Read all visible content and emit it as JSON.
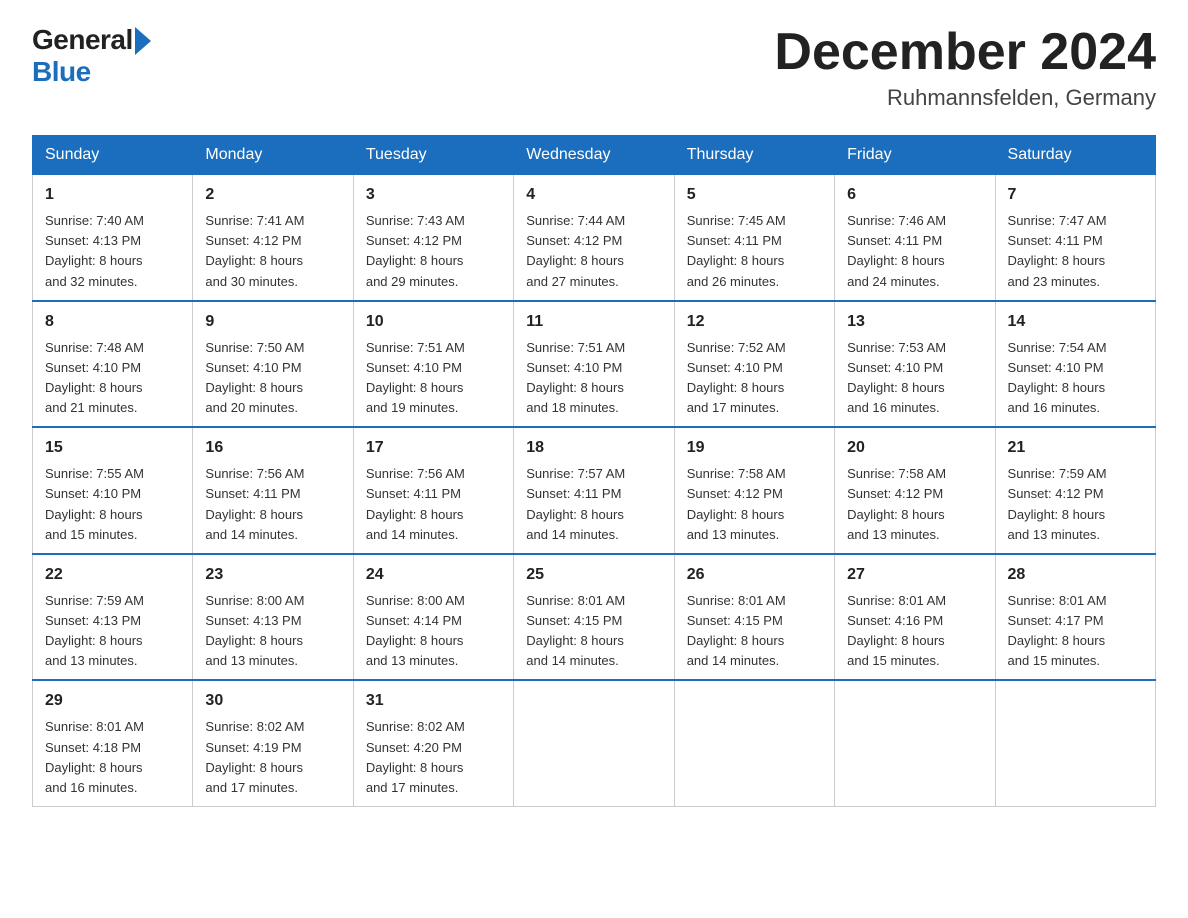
{
  "header": {
    "logo": {
      "general": "General",
      "blue": "Blue"
    },
    "title": "December 2024",
    "location": "Ruhmannsfelden, Germany"
  },
  "days_of_week": [
    "Sunday",
    "Monday",
    "Tuesday",
    "Wednesday",
    "Thursday",
    "Friday",
    "Saturday"
  ],
  "weeks": [
    [
      {
        "day": "1",
        "sunrise": "7:40 AM",
        "sunset": "4:13 PM",
        "daylight": "8 hours and 32 minutes."
      },
      {
        "day": "2",
        "sunrise": "7:41 AM",
        "sunset": "4:12 PM",
        "daylight": "8 hours and 30 minutes."
      },
      {
        "day": "3",
        "sunrise": "7:43 AM",
        "sunset": "4:12 PM",
        "daylight": "8 hours and 29 minutes."
      },
      {
        "day": "4",
        "sunrise": "7:44 AM",
        "sunset": "4:12 PM",
        "daylight": "8 hours and 27 minutes."
      },
      {
        "day": "5",
        "sunrise": "7:45 AM",
        "sunset": "4:11 PM",
        "daylight": "8 hours and 26 minutes."
      },
      {
        "day": "6",
        "sunrise": "7:46 AM",
        "sunset": "4:11 PM",
        "daylight": "8 hours and 24 minutes."
      },
      {
        "day": "7",
        "sunrise": "7:47 AM",
        "sunset": "4:11 PM",
        "daylight": "8 hours and 23 minutes."
      }
    ],
    [
      {
        "day": "8",
        "sunrise": "7:48 AM",
        "sunset": "4:10 PM",
        "daylight": "8 hours and 21 minutes."
      },
      {
        "day": "9",
        "sunrise": "7:50 AM",
        "sunset": "4:10 PM",
        "daylight": "8 hours and 20 minutes."
      },
      {
        "day": "10",
        "sunrise": "7:51 AM",
        "sunset": "4:10 PM",
        "daylight": "8 hours and 19 minutes."
      },
      {
        "day": "11",
        "sunrise": "7:51 AM",
        "sunset": "4:10 PM",
        "daylight": "8 hours and 18 minutes."
      },
      {
        "day": "12",
        "sunrise": "7:52 AM",
        "sunset": "4:10 PM",
        "daylight": "8 hours and 17 minutes."
      },
      {
        "day": "13",
        "sunrise": "7:53 AM",
        "sunset": "4:10 PM",
        "daylight": "8 hours and 16 minutes."
      },
      {
        "day": "14",
        "sunrise": "7:54 AM",
        "sunset": "4:10 PM",
        "daylight": "8 hours and 16 minutes."
      }
    ],
    [
      {
        "day": "15",
        "sunrise": "7:55 AM",
        "sunset": "4:10 PM",
        "daylight": "8 hours and 15 minutes."
      },
      {
        "day": "16",
        "sunrise": "7:56 AM",
        "sunset": "4:11 PM",
        "daylight": "8 hours and 14 minutes."
      },
      {
        "day": "17",
        "sunrise": "7:56 AM",
        "sunset": "4:11 PM",
        "daylight": "8 hours and 14 minutes."
      },
      {
        "day": "18",
        "sunrise": "7:57 AM",
        "sunset": "4:11 PM",
        "daylight": "8 hours and 14 minutes."
      },
      {
        "day": "19",
        "sunrise": "7:58 AM",
        "sunset": "4:12 PM",
        "daylight": "8 hours and 13 minutes."
      },
      {
        "day": "20",
        "sunrise": "7:58 AM",
        "sunset": "4:12 PM",
        "daylight": "8 hours and 13 minutes."
      },
      {
        "day": "21",
        "sunrise": "7:59 AM",
        "sunset": "4:12 PM",
        "daylight": "8 hours and 13 minutes."
      }
    ],
    [
      {
        "day": "22",
        "sunrise": "7:59 AM",
        "sunset": "4:13 PM",
        "daylight": "8 hours and 13 minutes."
      },
      {
        "day": "23",
        "sunrise": "8:00 AM",
        "sunset": "4:13 PM",
        "daylight": "8 hours and 13 minutes."
      },
      {
        "day": "24",
        "sunrise": "8:00 AM",
        "sunset": "4:14 PM",
        "daylight": "8 hours and 13 minutes."
      },
      {
        "day": "25",
        "sunrise": "8:01 AM",
        "sunset": "4:15 PM",
        "daylight": "8 hours and 14 minutes."
      },
      {
        "day": "26",
        "sunrise": "8:01 AM",
        "sunset": "4:15 PM",
        "daylight": "8 hours and 14 minutes."
      },
      {
        "day": "27",
        "sunrise": "8:01 AM",
        "sunset": "4:16 PM",
        "daylight": "8 hours and 15 minutes."
      },
      {
        "day": "28",
        "sunrise": "8:01 AM",
        "sunset": "4:17 PM",
        "daylight": "8 hours and 15 minutes."
      }
    ],
    [
      {
        "day": "29",
        "sunrise": "8:01 AM",
        "sunset": "4:18 PM",
        "daylight": "8 hours and 16 minutes."
      },
      {
        "day": "30",
        "sunrise": "8:02 AM",
        "sunset": "4:19 PM",
        "daylight": "8 hours and 17 minutes."
      },
      {
        "day": "31",
        "sunrise": "8:02 AM",
        "sunset": "4:20 PM",
        "daylight": "8 hours and 17 minutes."
      },
      null,
      null,
      null,
      null
    ]
  ],
  "labels": {
    "sunrise": "Sunrise:",
    "sunset": "Sunset:",
    "daylight": "Daylight:"
  }
}
